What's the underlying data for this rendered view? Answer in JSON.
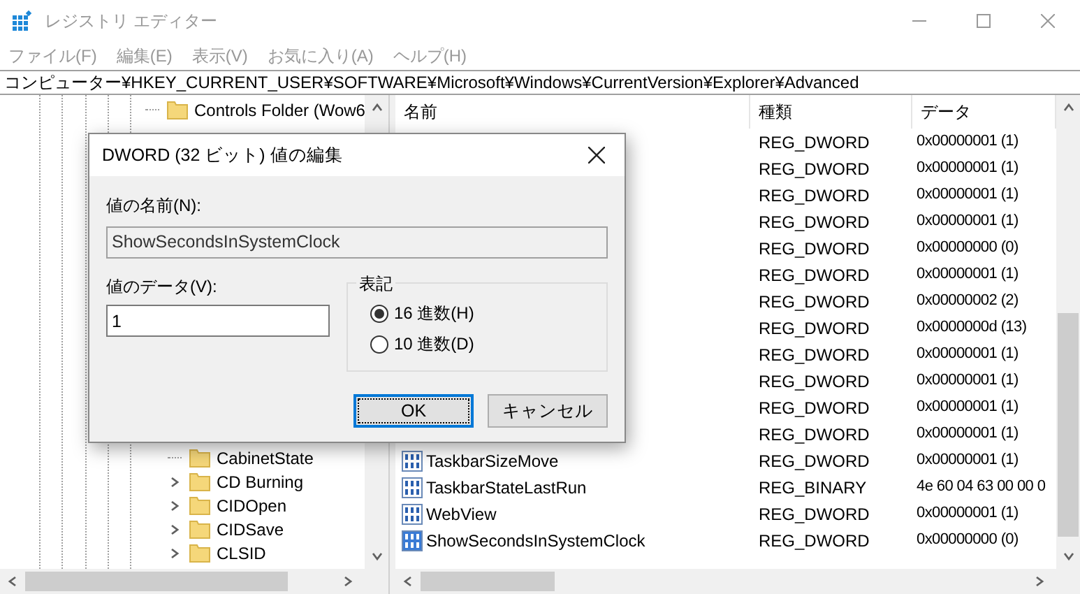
{
  "window": {
    "title": "レジストリ エディター"
  },
  "menu": [
    "ファイル(F)",
    "編集(E)",
    "表示(V)",
    "お気に入り(A)",
    "ヘルプ(H)"
  ],
  "address": "コンピューター¥HKEY_CURRENT_USER¥SOFTWARE¥Microsoft¥Windows¥CurrentVersion¥Explorer¥Advanced",
  "tree": {
    "items": [
      {
        "label": "Controls Folder (Wow6",
        "has_children": false
      },
      {
        "children": [
          {
            "label": "CabinetState",
            "has_children": false
          },
          {
            "label": "CD Burning",
            "has_children": true
          },
          {
            "label": "CIDOpen",
            "has_children": true
          },
          {
            "label": "CIDSave",
            "has_children": true
          },
          {
            "label": "CLSID",
            "has_children": true
          }
        ]
      }
    ]
  },
  "list": {
    "columns": [
      "名前",
      "種類",
      "データ"
    ],
    "rows": [
      {
        "type": "REG_DWORD",
        "data": "0x00000001 (1)"
      },
      {
        "type": "REG_DWORD",
        "data": "0x00000001 (1)"
      },
      {
        "type": "REG_DWORD",
        "data": "0x00000001 (1)"
      },
      {
        "type": "REG_DWORD",
        "data": "0x00000001 (1)"
      },
      {
        "type": "REG_DWORD",
        "data": "0x00000000 (0)"
      },
      {
        "type": "REG_DWORD",
        "data": "0x00000001 (1)"
      },
      {
        "type": "REG_DWORD",
        "data": "0x00000002 (2)"
      },
      {
        "type": "REG_DWORD",
        "data": "0x0000000d (13)"
      },
      {
        "type": "REG_DWORD",
        "data": "0x00000001 (1)"
      },
      {
        "type": "REG_DWORD",
        "data": "0x00000001 (1)"
      },
      {
        "type": "REG_DWORD",
        "data": "0x00000001 (1)"
      },
      {
        "type": "REG_DWORD",
        "data": "0x00000001 (1)"
      },
      {
        "name": "TaskbarSizeMove",
        "type": "REG_DWORD",
        "data": "0x00000001 (1)",
        "selected": false
      },
      {
        "name": "TaskbarStateLastRun",
        "type": "REG_BINARY",
        "data": "4e 60 04 63 00 00 0",
        "selected": false
      },
      {
        "name": "WebView",
        "type": "REG_DWORD",
        "data": "0x00000001 (1)",
        "selected": false
      },
      {
        "name": "ShowSecondsInSystemClock",
        "type": "REG_DWORD",
        "data": "0x00000000 (0)",
        "selected": true
      }
    ]
  },
  "dialog": {
    "title": "DWORD (32 ビット) 値の編集",
    "name_label": "値の名前(N):",
    "name_value": "ShowSecondsInSystemClock",
    "data_label": "値のデータ(V):",
    "data_value": "1",
    "base_label": "表記",
    "bases": [
      {
        "label": "16 進数(H)",
        "selected": true
      },
      {
        "label": "10 進数(D)",
        "selected": false
      }
    ],
    "buttons": [
      "OK",
      "キャンセル"
    ]
  }
}
